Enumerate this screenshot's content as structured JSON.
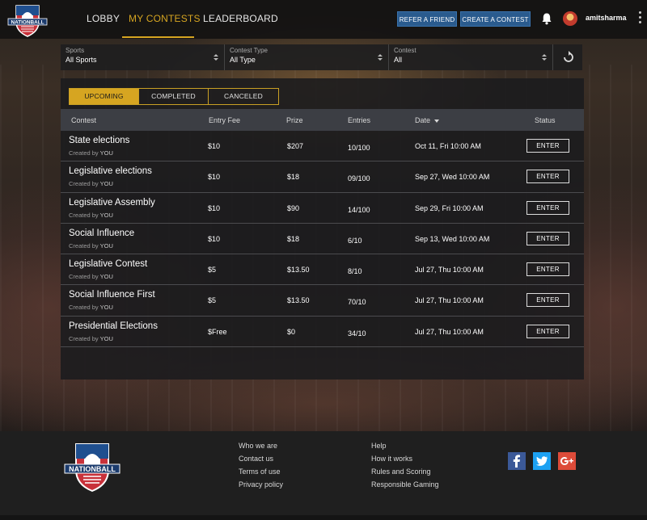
{
  "brand": {
    "logo_text": "NATIONBALL"
  },
  "nav": {
    "items": [
      {
        "label": "LOBBY"
      },
      {
        "label": "MY CONTESTS",
        "active": true
      },
      {
        "label": "LEADERBOARD"
      }
    ]
  },
  "header": {
    "refer_label": "REFER A FRIEND",
    "create_label": "CREATE A CONTEST",
    "username": "amitsharma"
  },
  "filters": [
    {
      "label": "Sports",
      "value": "All Sports"
    },
    {
      "label": "Contest Type",
      "value": "All Type"
    },
    {
      "label": "Contest",
      "value": "All"
    }
  ],
  "tabs": [
    {
      "label": "UPCOMING",
      "active": true
    },
    {
      "label": "COMPLETED"
    },
    {
      "label": "CANCELED"
    }
  ],
  "table": {
    "headers": {
      "contest": "Contest",
      "entry_fee": "Entry Fee",
      "prize": "Prize",
      "entries": "Entries",
      "date": "Date",
      "status": "Status"
    },
    "rows": [
      {
        "name": "State elections",
        "created_by_prefix": "Created by",
        "created_by": "YOU",
        "fee": "$10",
        "prize": "$207",
        "entries": "10/100",
        "date": "Oct 11, Fri 10:00 AM",
        "action": "ENTER"
      },
      {
        "name": "Legislative elections",
        "created_by_prefix": "Created by",
        "created_by": "YOU",
        "fee": "$10",
        "prize": "$18",
        "entries": "09/100",
        "date": "Sep 27, Wed 10:00 AM",
        "action": "ENTER"
      },
      {
        "name": "Legislative Assembly",
        "created_by_prefix": "Created by",
        "created_by": "YOU",
        "fee": "$10",
        "prize": "$90",
        "entries": "14/100",
        "date": "Sep 29, Fri 10:00 AM",
        "action": "ENTER"
      },
      {
        "name": "Social Influence",
        "created_by_prefix": "Created by",
        "created_by": "YOU",
        "fee": "$10",
        "prize": "$18",
        "entries": "6/10",
        "date": "Sep 13, Wed 10:00 AM",
        "action": "ENTER"
      },
      {
        "name": "Legislative Contest",
        "created_by_prefix": "Created by",
        "created_by": "YOU",
        "fee": "$5",
        "prize": "$13.50",
        "entries": "8/10",
        "date": "Jul 27, Thu 10:00 AM",
        "action": "ENTER"
      },
      {
        "name": "Social Influence First",
        "created_by_prefix": "Created by",
        "created_by": "YOU",
        "fee": "$5",
        "prize": "$13.50",
        "entries": "70/10",
        "date": "Jul 27, Thu 10:00 AM",
        "action": "ENTER"
      },
      {
        "name": "Presidential Elections",
        "created_by_prefix": "Created by",
        "created_by": "YOU",
        "fee": "$Free",
        "prize": "$0",
        "entries": "34/10",
        "date": "Jul 27, Thu 10:00 AM",
        "action": "ENTER"
      }
    ]
  },
  "footer": {
    "col1": [
      "Who we are",
      "Contact us",
      "Terms of use",
      "Privacy policy"
    ],
    "col2": [
      "Help",
      "How it works",
      "Rules and Scoring",
      "Responsible Gaming"
    ],
    "social": [
      {
        "icon": "facebook-icon",
        "glyph": "f",
        "color": "#3b5998"
      },
      {
        "icon": "twitter-icon",
        "glyph": "t",
        "color": "#1da1f2"
      },
      {
        "icon": "google-plus-icon",
        "glyph": "g+",
        "color": "#dd4b39"
      }
    ]
  },
  "colors": {
    "accent": "#d6a521",
    "button_blue": "#2a5b8e"
  }
}
